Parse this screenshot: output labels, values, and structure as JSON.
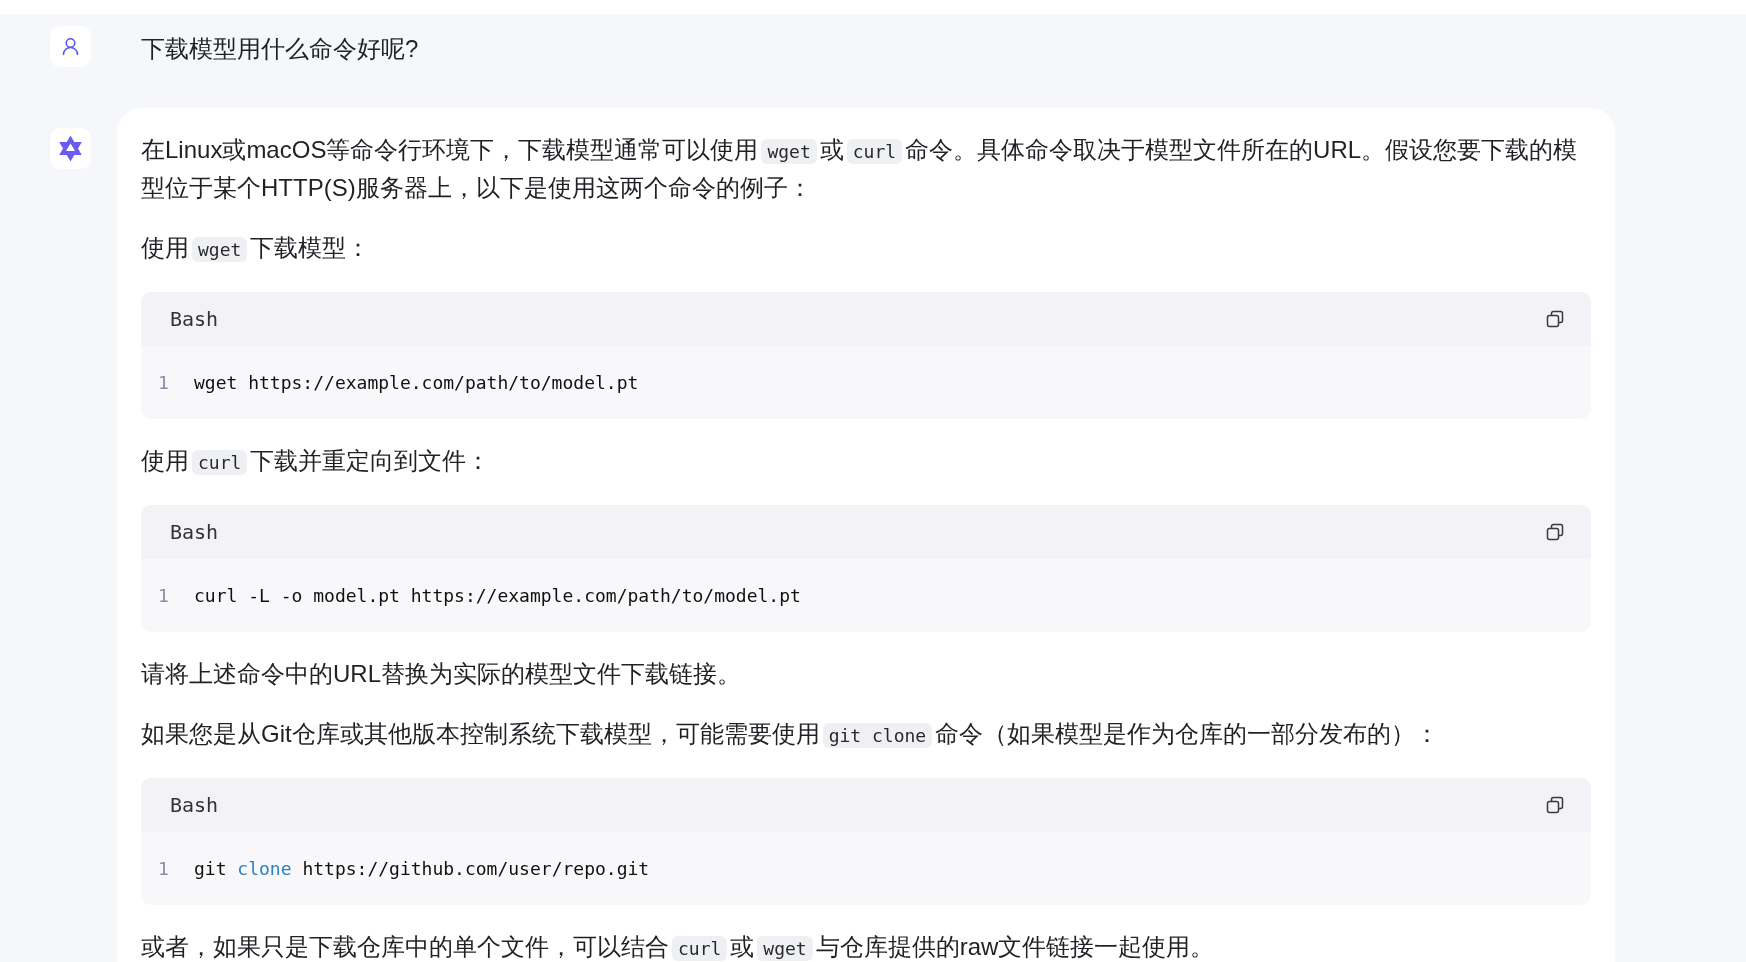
{
  "conversation": [
    {
      "kind": "user",
      "text": "下载模型用什么命令好呢?"
    },
    {
      "kind": "assistant",
      "blocks": [
        {
          "kind": "paragraph",
          "parts": [
            {
              "kind": "text",
              "text": "在Linux或macOS等命令行环境下，下载模型通常可以使用"
            },
            {
              "kind": "code",
              "text": "wget"
            },
            {
              "kind": "text",
              "text": "或"
            },
            {
              "kind": "code",
              "text": "curl"
            },
            {
              "kind": "text",
              "text": "命令。具体命令取决于模型文件所在的URL。假设您要下载的模型位于某个HTTP(S)服务器上，以下是使用这两个命令的例子："
            }
          ]
        },
        {
          "kind": "paragraph",
          "parts": [
            {
              "kind": "text",
              "text": "使用"
            },
            {
              "kind": "code",
              "text": "wget"
            },
            {
              "kind": "text",
              "text": "下载模型："
            }
          ]
        },
        {
          "kind": "code_block",
          "language": "Bash",
          "lines": [
            {
              "number": "1",
              "tokens": [
                {
                  "kind": "plain",
                  "text": "wget https://example.com/path/to/model.pt"
                }
              ]
            }
          ]
        },
        {
          "kind": "paragraph",
          "parts": [
            {
              "kind": "text",
              "text": "使用"
            },
            {
              "kind": "code",
              "text": "curl"
            },
            {
              "kind": "text",
              "text": "下载并重定向到文件："
            }
          ]
        },
        {
          "kind": "code_block",
          "language": "Bash",
          "lines": [
            {
              "number": "1",
              "tokens": [
                {
                  "kind": "plain",
                  "text": "curl -L -o model.pt https://example.com/path/to/model.pt"
                }
              ]
            }
          ]
        },
        {
          "kind": "paragraph",
          "parts": [
            {
              "kind": "text",
              "text": "请将上述命令中的URL替换为实际的模型文件下载链接。"
            }
          ]
        },
        {
          "kind": "paragraph",
          "parts": [
            {
              "kind": "text",
              "text": "如果您是从Git仓库或其他版本控制系统下载模型，可能需要使用"
            },
            {
              "kind": "code",
              "text": "git clone"
            },
            {
              "kind": "text",
              "text": "命令（如果模型是作为仓库的一部分发布的）："
            }
          ]
        },
        {
          "kind": "code_block",
          "language": "Bash",
          "lines": [
            {
              "number": "1",
              "tokens": [
                {
                  "kind": "plain",
                  "text": "git "
                },
                {
                  "kind": "keyword",
                  "text": "clone"
                },
                {
                  "kind": "plain",
                  "text": " https://github.com/user/repo.git"
                }
              ]
            }
          ]
        },
        {
          "kind": "paragraph",
          "parts": [
            {
              "kind": "text",
              "text": "或者，如果只是下载仓库中的单个文件，可以结合"
            },
            {
              "kind": "code",
              "text": "curl"
            },
            {
              "kind": "text",
              "text": "或"
            },
            {
              "kind": "code",
              "text": "wget"
            },
            {
              "kind": "text",
              "text": "与仓库提供的raw文件链接一起使用。"
            }
          ]
        }
      ]
    }
  ]
}
